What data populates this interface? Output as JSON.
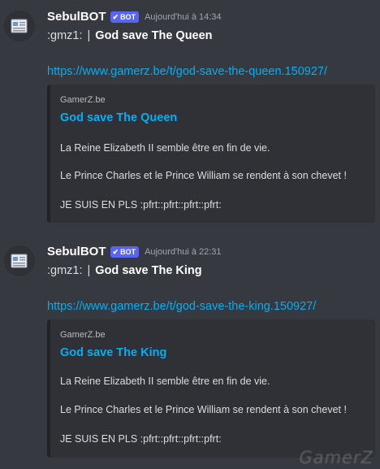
{
  "messages": [
    {
      "username": "SebulBOT",
      "bot_tag": "BOT",
      "check": "✔",
      "timestamp": "Aujourd'hui à 14:34",
      "emoji_code": ":gmz1:",
      "separator": "|",
      "headline": "God save The Queen",
      "link": "https://www.gamerz.be/t/god-save-the-queen.150927/",
      "embed": {
        "provider": "GamerZ.be",
        "title": "God save The Queen",
        "lines": [
          "La Reine Elizabeth II semble être en fin de vie.",
          "Le Prince Charles et le Prince William se rendent à son chevet !",
          "JE SUIS EN PLS :pfrt::pfrt::pfrt::pfrt:"
        ]
      }
    },
    {
      "username": "SebulBOT",
      "bot_tag": "BOT",
      "check": "✔",
      "timestamp": "Aujourd'hui à 22:31",
      "emoji_code": ":gmz1:",
      "separator": "|",
      "headline": "God save The King",
      "link": "https://www.gamerz.be/t/god-save-the-king.150927/",
      "embed": {
        "provider": "GamerZ.be",
        "title": "God save The King",
        "lines": [
          "La Reine Elizabeth II semble être en fin de vie.",
          "Le Prince Charles et le Prince William se rendent à son chevet !",
          "JE SUIS EN PLS :pfrt::pfrt::pfrt::pfrt:"
        ]
      }
    }
  ],
  "watermark": "GamerZ",
  "colors": {
    "background": "#36393f",
    "embed_background": "#2f3136",
    "link": "#00aff4",
    "bot_tag": "#5865f2"
  },
  "icons": [
    "newspaper-icon",
    "check-icon"
  ]
}
